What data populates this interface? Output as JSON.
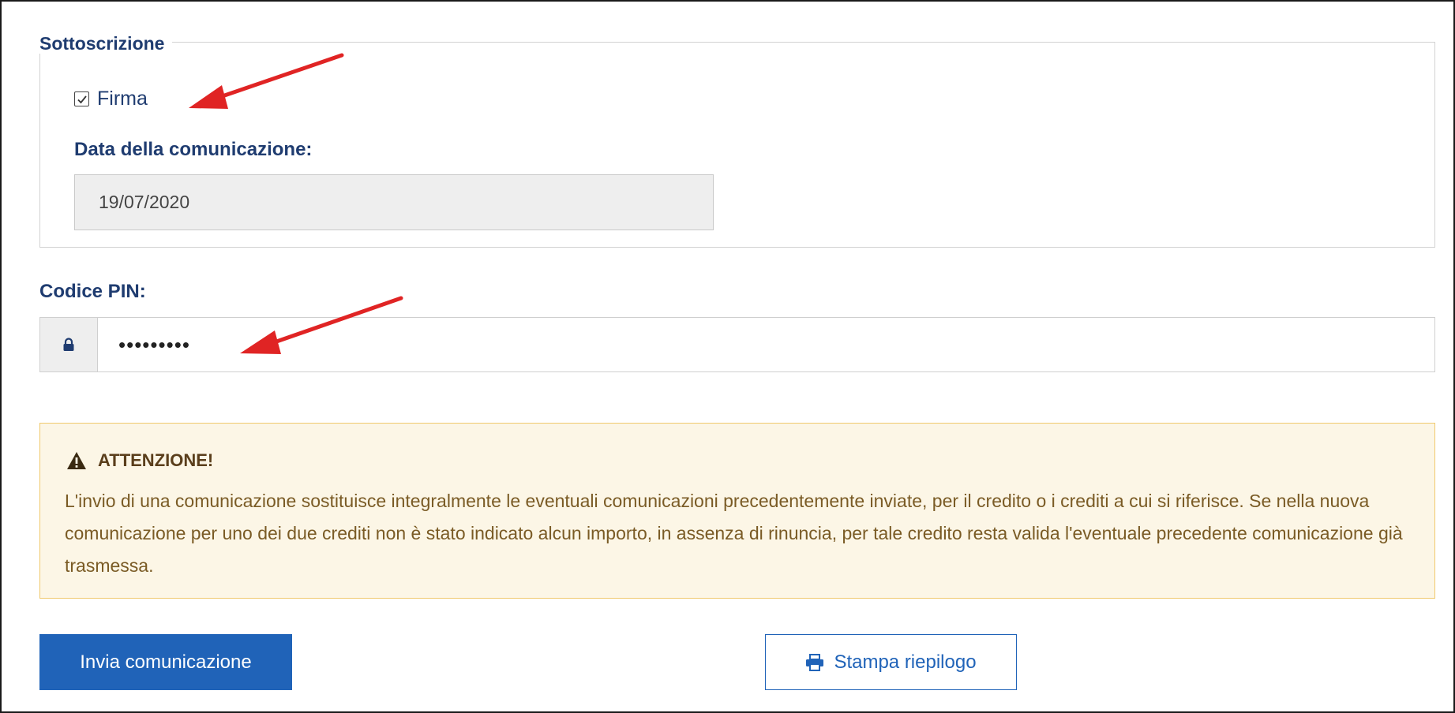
{
  "fieldset": {
    "legend": "Sottoscrizione",
    "checkbox": {
      "label": "Firma",
      "checked": true
    },
    "date_label": "Data della comunicazione:",
    "date_value": "19/07/2020"
  },
  "pin": {
    "label": "Codice PIN:",
    "value": "•••••••••",
    "icon": "lock-icon"
  },
  "alert": {
    "icon": "warning-icon",
    "title": "ATTENZIONE!",
    "body": "L'invio di una comunicazione sostituisce integralmente le eventuali comunicazioni precedentemente inviate, per il credito o i crediti a cui si riferisce. Se nella nuova comunicazione per uno dei due crediti non è stato indicato alcun importo, in assenza di rinuncia, per tale credito resta valida l'eventuale precedente comunicazione già trasmessa."
  },
  "actions": {
    "submit_label": "Invia comunicazione",
    "print_label": "Stampa riepilogo",
    "print_icon": "printer-icon"
  },
  "colors": {
    "heading": "#1f3c70",
    "primary": "#2063b8",
    "alert_bg": "#fcf6e6",
    "alert_border": "#f0c96c",
    "annotation_arrow": "#e02424"
  }
}
